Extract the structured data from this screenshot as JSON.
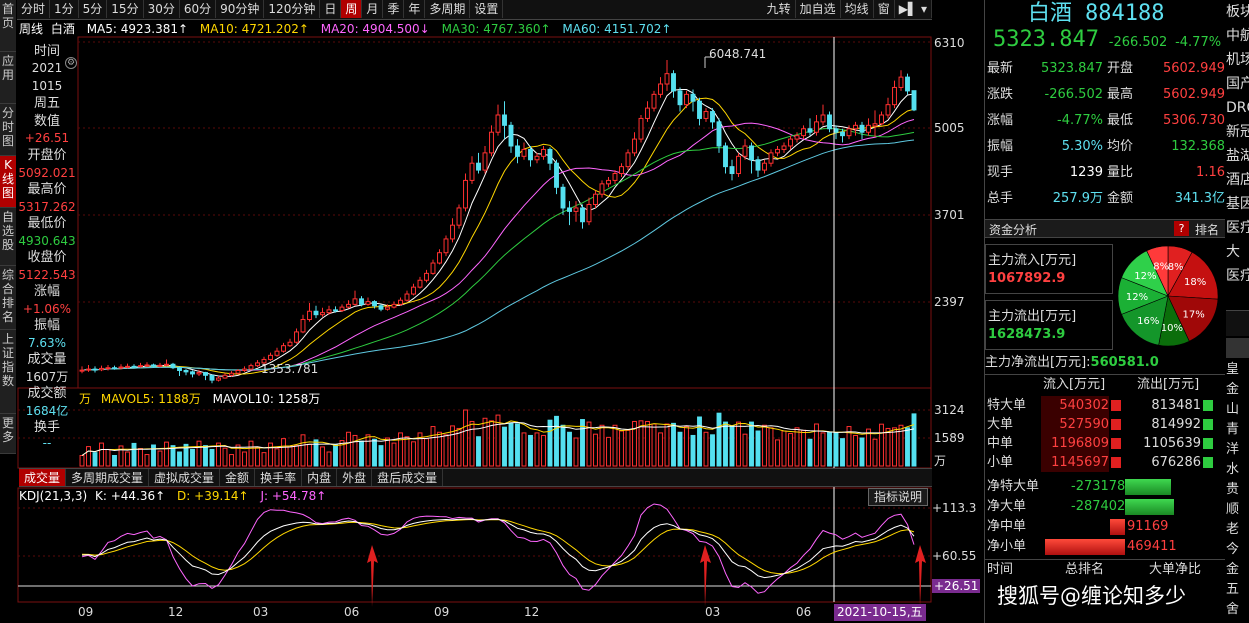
{
  "left_tabs": [
    "首页",
    "应用",
    "分时图",
    "K线图",
    "自选股",
    "综合排名",
    "上证指数",
    "更多"
  ],
  "toolbar": {
    "items": [
      "分时",
      "1分",
      "5分",
      "15分",
      "30分",
      "60分",
      "90分钟",
      "120分钟",
      "日",
      "周",
      "月",
      "季",
      "年",
      "多周期",
      "设置"
    ],
    "active": "周",
    "right": [
      "九转",
      "加自选",
      "均线",
      "窗"
    ]
  },
  "ma_bar": {
    "period": "周线",
    "name": "白酒",
    "ma5": "MA5: 4923.381↑",
    "ma10": "MA10: 4721.202↑",
    "ma20": "MA20: 4904.500↓",
    "ma30": "MA30: 4767.360↑",
    "ma60": "MA60: 4151.702↑"
  },
  "info": {
    "items": [
      {
        "label": "时间",
        "value": "2021",
        "color": "#ddd"
      },
      {
        "label": "",
        "value": "1015",
        "color": "#ddd"
      },
      {
        "label": "周五",
        "value": "",
        "color": "#ddd"
      },
      {
        "label": "数值",
        "value": "+26.51",
        "color": "#ff4040"
      },
      {
        "label": "开盘价",
        "value": "5092.021",
        "color": "#ff4040"
      },
      {
        "label": "最高价",
        "value": "5317.262",
        "color": "#ff4040"
      },
      {
        "label": "最低价",
        "value": "4930.643",
        "color": "#2ecc40"
      },
      {
        "label": "收盘价",
        "value": "5122.543",
        "color": "#ff4040"
      },
      {
        "label": "涨幅",
        "value": "+1.06%",
        "color": "#ff4040"
      },
      {
        "label": "振幅",
        "value": "7.63%",
        "color": "#5ee0f0"
      },
      {
        "label": "成交量",
        "value": "1607万",
        "color": "#ddd"
      },
      {
        "label": "成交额",
        "value": "1684亿",
        "color": "#5ee0f0"
      },
      {
        "label": "换手",
        "value": "--",
        "color": "#5ee0f0"
      }
    ]
  },
  "price_axis": [
    "6310",
    "5005",
    "3701",
    "2397"
  ],
  "annotations": {
    "high": "6048.741",
    "low": "1353.781"
  },
  "volume": {
    "label": "万",
    "mavol5": "MAVOL5: 1188万",
    "mavol10": "MAVOL10: 1258万",
    "axis": [
      "3124",
      "1589",
      "万"
    ]
  },
  "sub_tabs": [
    "成交量",
    "多周期成交量",
    "虚拟成交量",
    "金额",
    "换手率",
    "内盘",
    "外盘",
    "盘后成交量"
  ],
  "kdj": {
    "title": "KDJ(21,3,3)",
    "k": "K: +44.36↑",
    "d": "D: +39.14↑",
    "j": "J: +54.78↑",
    "axis": [
      "+113.3",
      "+60.55",
      "+26.51"
    ],
    "button": "指标说明"
  },
  "x_axis": [
    "09",
    "12",
    "03",
    "06",
    "09",
    "12",
    "03",
    "06",
    "09"
  ],
  "cursor_date": "2021-10-15,五",
  "quote": {
    "name": "白酒",
    "code": "884188",
    "price": "5323.847",
    "change": "-266.502",
    "pct": "-4.77%",
    "rows": [
      [
        "最新",
        "5323.847",
        "开盘",
        "5602.949"
      ],
      [
        "涨跌",
        "-266.502",
        "最高",
        "5602.949"
      ],
      [
        "涨幅",
        "-4.77%",
        "最低",
        "5306.730"
      ],
      [
        "振幅",
        "5.30%",
        "均价",
        "132.368"
      ],
      [
        "现手",
        "1239",
        "量比",
        "1.16"
      ],
      [
        "总手",
        "257.9万",
        "金额",
        "341.3亿"
      ]
    ]
  },
  "fund": {
    "title": "资金分析",
    "rank": "排名",
    "help": "?",
    "inflow_label": "主力流入[万元]",
    "inflow": "1067892.9",
    "outflow_label": "主力流出[万元]",
    "outflow": "1628473.9",
    "net_label": "主力净流出[万元]:",
    "net": "560581.0",
    "pie": [
      {
        "label": "8%",
        "value": 8,
        "color": "#e02020"
      },
      {
        "label": "18%",
        "value": 18,
        "color": "#c41010"
      },
      {
        "label": "17%",
        "value": 17,
        "color": "#a00808"
      },
      {
        "label": "10%",
        "value": 10,
        "color": "#0b6e0b"
      },
      {
        "label": "16%",
        "value": 16,
        "color": "#14962a"
      },
      {
        "label": "12%",
        "value": 12,
        "color": "#1bb035"
      },
      {
        "label": "12%",
        "value": 12,
        "color": "#2fd04a"
      },
      {
        "label": "8%",
        "value": 7,
        "color": "#ff3a3a"
      }
    ],
    "header": [
      "流入[万元]",
      "流出[万元]"
    ],
    "orders": [
      {
        "name": "特大单",
        "in": "540302",
        "out": "813481"
      },
      {
        "name": "大单",
        "in": "527590",
        "out": "814992"
      },
      {
        "name": "中单",
        "in": "1196809",
        "out": "1105639"
      },
      {
        "name": "小单",
        "in": "1145697",
        "out": "676286"
      }
    ],
    "net_rows": [
      {
        "name": "净特大单",
        "value": "-273178",
        "dir": "neg",
        "frac": 0.58
      },
      {
        "name": "净大单",
        "value": "-287402",
        "dir": "neg",
        "frac": 0.61
      },
      {
        "name": "净中单",
        "value": "91169",
        "dir": "pos",
        "frac": 0.19
      },
      {
        "name": "净小单",
        "value": "469411",
        "dir": "pos",
        "frac": 1.0
      }
    ],
    "bottom_header": [
      "时间",
      "总排名",
      "大单净比"
    ],
    "watermark": "搜狐号@缠论知多少"
  },
  "right_strip": [
    "板块",
    "中航",
    "机场",
    "国产",
    "DRG",
    "新冠",
    "盐湖",
    "酒店",
    "基因",
    "医疗",
    "大",
    "医疗",
    "",
    "皇",
    "金",
    "山",
    "青",
    "洋",
    "水",
    "贵",
    "顺",
    "老",
    "今",
    "金",
    "五",
    "舍"
  ],
  "chart_data": {
    "type": "candlestick",
    "title": "白酒 884188 周线",
    "candles": [
      {
        "o": 1530,
        "c": 1545,
        "h": 1600,
        "l": 1500
      },
      {
        "o": 1545,
        "c": 1560,
        "h": 1620,
        "l": 1520
      },
      {
        "o": 1560,
        "c": 1550,
        "h": 1600,
        "l": 1510
      },
      {
        "o": 1550,
        "c": 1570,
        "h": 1610,
        "l": 1530
      },
      {
        "o": 1570,
        "c": 1580,
        "h": 1620,
        "l": 1540
      },
      {
        "o": 1580,
        "c": 1575,
        "h": 1610,
        "l": 1550
      },
      {
        "o": 1575,
        "c": 1590,
        "h": 1630,
        "l": 1560
      },
      {
        "o": 1590,
        "c": 1600,
        "h": 1640,
        "l": 1570
      },
      {
        "o": 1600,
        "c": 1595,
        "h": 1630,
        "l": 1570
      },
      {
        "o": 1595,
        "c": 1610,
        "h": 1650,
        "l": 1580
      },
      {
        "o": 1610,
        "c": 1620,
        "h": 1660,
        "l": 1590
      },
      {
        "o": 1620,
        "c": 1600,
        "h": 1640,
        "l": 1580
      },
      {
        "o": 1600,
        "c": 1615,
        "h": 1650,
        "l": 1585
      },
      {
        "o": 1615,
        "c": 1630,
        "h": 1700,
        "l": 1600
      },
      {
        "o": 1630,
        "c": 1580,
        "h": 1650,
        "l": 1560
      },
      {
        "o": 1580,
        "c": 1540,
        "h": 1600,
        "l": 1460
      },
      {
        "o": 1540,
        "c": 1520,
        "h": 1560,
        "l": 1470
      },
      {
        "o": 1520,
        "c": 1490,
        "h": 1540,
        "l": 1440
      },
      {
        "o": 1490,
        "c": 1510,
        "h": 1550,
        "l": 1460
      },
      {
        "o": 1510,
        "c": 1470,
        "h": 1520,
        "l": 1400
      },
      {
        "o": 1470,
        "c": 1400,
        "h": 1480,
        "l": 1354
      },
      {
        "o": 1400,
        "c": 1430,
        "h": 1460,
        "l": 1380
      },
      {
        "o": 1430,
        "c": 1470,
        "h": 1500,
        "l": 1420
      },
      {
        "o": 1470,
        "c": 1500,
        "h": 1530,
        "l": 1450
      },
      {
        "o": 1500,
        "c": 1540,
        "h": 1560,
        "l": 1480
      },
      {
        "o": 1540,
        "c": 1560,
        "h": 1600,
        "l": 1520
      },
      {
        "o": 1560,
        "c": 1610,
        "h": 1640,
        "l": 1540
      },
      {
        "o": 1610,
        "c": 1650,
        "h": 1690,
        "l": 1590
      },
      {
        "o": 1650,
        "c": 1700,
        "h": 1740,
        "l": 1630
      },
      {
        "o": 1700,
        "c": 1760,
        "h": 1800,
        "l": 1680
      },
      {
        "o": 1760,
        "c": 1820,
        "h": 1870,
        "l": 1740
      },
      {
        "o": 1820,
        "c": 1900,
        "h": 1940,
        "l": 1800
      },
      {
        "o": 1900,
        "c": 1950,
        "h": 2000,
        "l": 1880
      },
      {
        "o": 1950,
        "c": 2100,
        "h": 2150,
        "l": 1930
      },
      {
        "o": 2100,
        "c": 2280,
        "h": 2350,
        "l": 2080
      },
      {
        "o": 2280,
        "c": 2400,
        "h": 2520,
        "l": 2250
      },
      {
        "o": 2400,
        "c": 2350,
        "h": 2480,
        "l": 2300
      },
      {
        "o": 2350,
        "c": 2380,
        "h": 2450,
        "l": 2320
      },
      {
        "o": 2380,
        "c": 2420,
        "h": 2480,
        "l": 2350
      },
      {
        "o": 2420,
        "c": 2410,
        "h": 2470,
        "l": 2380
      },
      {
        "o": 2410,
        "c": 2460,
        "h": 2500,
        "l": 2390
      },
      {
        "o": 2460,
        "c": 2500,
        "h": 2560,
        "l": 2440
      },
      {
        "o": 2500,
        "c": 2580,
        "h": 2700,
        "l": 2480
      },
      {
        "o": 2580,
        "c": 2500,
        "h": 2620,
        "l": 2470
      },
      {
        "o": 2500,
        "c": 2540,
        "h": 2600,
        "l": 2480
      },
      {
        "o": 2540,
        "c": 2480,
        "h": 2560,
        "l": 2440
      },
      {
        "o": 2480,
        "c": 2430,
        "h": 2500,
        "l": 2400
      },
      {
        "o": 2430,
        "c": 2460,
        "h": 2500,
        "l": 2410
      },
      {
        "o": 2460,
        "c": 2500,
        "h": 2540,
        "l": 2440
      },
      {
        "o": 2500,
        "c": 2560,
        "h": 2600,
        "l": 2480
      },
      {
        "o": 2560,
        "c": 2650,
        "h": 2700,
        "l": 2540
      },
      {
        "o": 2650,
        "c": 2750,
        "h": 2800,
        "l": 2630
      },
      {
        "o": 2750,
        "c": 2850,
        "h": 2900,
        "l": 2730
      },
      {
        "o": 2850,
        "c": 2950,
        "h": 3000,
        "l": 2820
      },
      {
        "o": 2950,
        "c": 3100,
        "h": 3150,
        "l": 2930
      },
      {
        "o": 3100,
        "c": 3250,
        "h": 3300,
        "l": 3080
      },
      {
        "o": 3250,
        "c": 3450,
        "h": 3500,
        "l": 3200
      },
      {
        "o": 3450,
        "c": 3650,
        "h": 3750,
        "l": 3400
      },
      {
        "o": 3650,
        "c": 3900,
        "h": 3950,
        "l": 3600
      },
      {
        "o": 3900,
        "c": 4300,
        "h": 4400,
        "l": 3850
      },
      {
        "o": 4300,
        "c": 4550,
        "h": 4650,
        "l": 4250
      },
      {
        "o": 4550,
        "c": 4450,
        "h": 4700,
        "l": 4400
      },
      {
        "o": 4450,
        "c": 4700,
        "h": 4800,
        "l": 4400
      },
      {
        "o": 4700,
        "c": 5000,
        "h": 5100,
        "l": 4650
      },
      {
        "o": 5000,
        "c": 5250,
        "h": 5400,
        "l": 4950
      },
      {
        "o": 5250,
        "c": 5100,
        "h": 5450,
        "l": 4900
      },
      {
        "o": 5100,
        "c": 4800,
        "h": 5150,
        "l": 4700
      },
      {
        "o": 4800,
        "c": 4650,
        "h": 4900,
        "l": 4550
      },
      {
        "o": 4650,
        "c": 4750,
        "h": 4850,
        "l": 4600
      },
      {
        "o": 4750,
        "c": 4600,
        "h": 4800,
        "l": 4500
      },
      {
        "o": 4600,
        "c": 4650,
        "h": 4700,
        "l": 4550
      },
      {
        "o": 4650,
        "c": 4750,
        "h": 4800,
        "l": 4600
      },
      {
        "o": 4750,
        "c": 4550,
        "h": 4780,
        "l": 4450
      },
      {
        "o": 4550,
        "c": 4200,
        "h": 4600,
        "l": 4100
      },
      {
        "o": 4200,
        "c": 3900,
        "h": 4250,
        "l": 3800
      },
      {
        "o": 3900,
        "c": 3850,
        "h": 4000,
        "l": 3650
      },
      {
        "o": 3850,
        "c": 3900,
        "h": 4000,
        "l": 3700
      },
      {
        "o": 3900,
        "c": 3700,
        "h": 3950,
        "l": 3600
      },
      {
        "o": 3700,
        "c": 3950,
        "h": 4050,
        "l": 3650
      },
      {
        "o": 3950,
        "c": 4100,
        "h": 4150,
        "l": 3900
      },
      {
        "o": 4100,
        "c": 4250,
        "h": 4300,
        "l": 4050
      },
      {
        "o": 4250,
        "c": 4300,
        "h": 4350,
        "l": 4200
      },
      {
        "o": 4300,
        "c": 4400,
        "h": 4450,
        "l": 4250
      },
      {
        "o": 4400,
        "c": 4500,
        "h": 4550,
        "l": 4350
      },
      {
        "o": 4500,
        "c": 4700,
        "h": 4750,
        "l": 4450
      },
      {
        "o": 4700,
        "c": 4900,
        "h": 5000,
        "l": 4650
      },
      {
        "o": 4900,
        "c": 5200,
        "h": 5250,
        "l": 4850
      },
      {
        "o": 5200,
        "c": 5350,
        "h": 5450,
        "l": 5150
      },
      {
        "o": 5350,
        "c": 5550,
        "h": 5600,
        "l": 5300
      },
      {
        "o": 5550,
        "c": 5700,
        "h": 5800,
        "l": 5500
      },
      {
        "o": 5700,
        "c": 5850,
        "h": 6049,
        "l": 5600
      },
      {
        "o": 5850,
        "c": 5600,
        "h": 5900,
        "l": 5500
      },
      {
        "o": 5600,
        "c": 5400,
        "h": 5650,
        "l": 5300
      },
      {
        "o": 5400,
        "c": 5550,
        "h": 5600,
        "l": 5350
      },
      {
        "o": 5550,
        "c": 5450,
        "h": 5620,
        "l": 5300
      },
      {
        "o": 5450,
        "c": 5200,
        "h": 5500,
        "l": 5100
      },
      {
        "o": 5200,
        "c": 5300,
        "h": 5350,
        "l": 5150
      },
      {
        "o": 5300,
        "c": 5150,
        "h": 5350,
        "l": 5050
      },
      {
        "o": 5150,
        "c": 4800,
        "h": 5200,
        "l": 4700
      },
      {
        "o": 4800,
        "c": 4500,
        "h": 4850,
        "l": 4400
      },
      {
        "o": 4500,
        "c": 4400,
        "h": 4600,
        "l": 4300
      },
      {
        "o": 4400,
        "c": 4650,
        "h": 4700,
        "l": 4350
      },
      {
        "o": 4650,
        "c": 4800,
        "h": 4900,
        "l": 4600
      },
      {
        "o": 4800,
        "c": 4600,
        "h": 4850,
        "l": 4400
      },
      {
        "o": 4600,
        "c": 4450,
        "h": 4650,
        "l": 4350
      },
      {
        "o": 4450,
        "c": 4550,
        "h": 4600,
        "l": 4400
      },
      {
        "o": 4550,
        "c": 4700,
        "h": 4750,
        "l": 4500
      },
      {
        "o": 4700,
        "c": 4750,
        "h": 4800,
        "l": 4650
      },
      {
        "o": 4750,
        "c": 4800,
        "h": 4850,
        "l": 4700
      },
      {
        "o": 4800,
        "c": 4900,
        "h": 4950,
        "l": 4750
      },
      {
        "o": 4900,
        "c": 4950,
        "h": 5000,
        "l": 4850
      },
      {
        "o": 4950,
        "c": 5050,
        "h": 5100,
        "l": 4900
      },
      {
        "o": 5050,
        "c": 5000,
        "h": 5200,
        "l": 4950
      },
      {
        "o": 5000,
        "c": 5150,
        "h": 5250,
        "l": 4950
      },
      {
        "o": 5150,
        "c": 5250,
        "h": 5400,
        "l": 5100
      },
      {
        "o": 5250,
        "c": 5050,
        "h": 5300,
        "l": 5000
      },
      {
        "o": 5050,
        "c": 5000,
        "h": 5100,
        "l": 4900
      },
      {
        "o": 5000,
        "c": 4950,
        "h": 5050,
        "l": 4850
      },
      {
        "o": 4950,
        "c": 5050,
        "h": 5100,
        "l": 4900
      },
      {
        "o": 5050,
        "c": 5100,
        "h": 5150,
        "l": 4950
      },
      {
        "o": 5100,
        "c": 5000,
        "h": 5150,
        "l": 4900
      },
      {
        "o": 5000,
        "c": 5100,
        "h": 5200,
        "l": 4950
      },
      {
        "o": 5092,
        "c": 5123,
        "h": 5317,
        "l": 4931
      },
      {
        "o": 5123,
        "c": 5250,
        "h": 5300,
        "l": 5100
      },
      {
        "o": 5250,
        "c": 5400,
        "h": 5500,
        "l": 5200
      },
      {
        "o": 5400,
        "c": 5650,
        "h": 5750,
        "l": 5350
      },
      {
        "o": 5650,
        "c": 5800,
        "h": 5900,
        "l": 5600
      },
      {
        "o": 5800,
        "c": 5600,
        "h": 5850,
        "l": 5550
      },
      {
        "o": 5603,
        "c": 5324,
        "h": 5603,
        "l": 5307
      }
    ],
    "ylim": [
      1300,
      6310
    ]
  }
}
